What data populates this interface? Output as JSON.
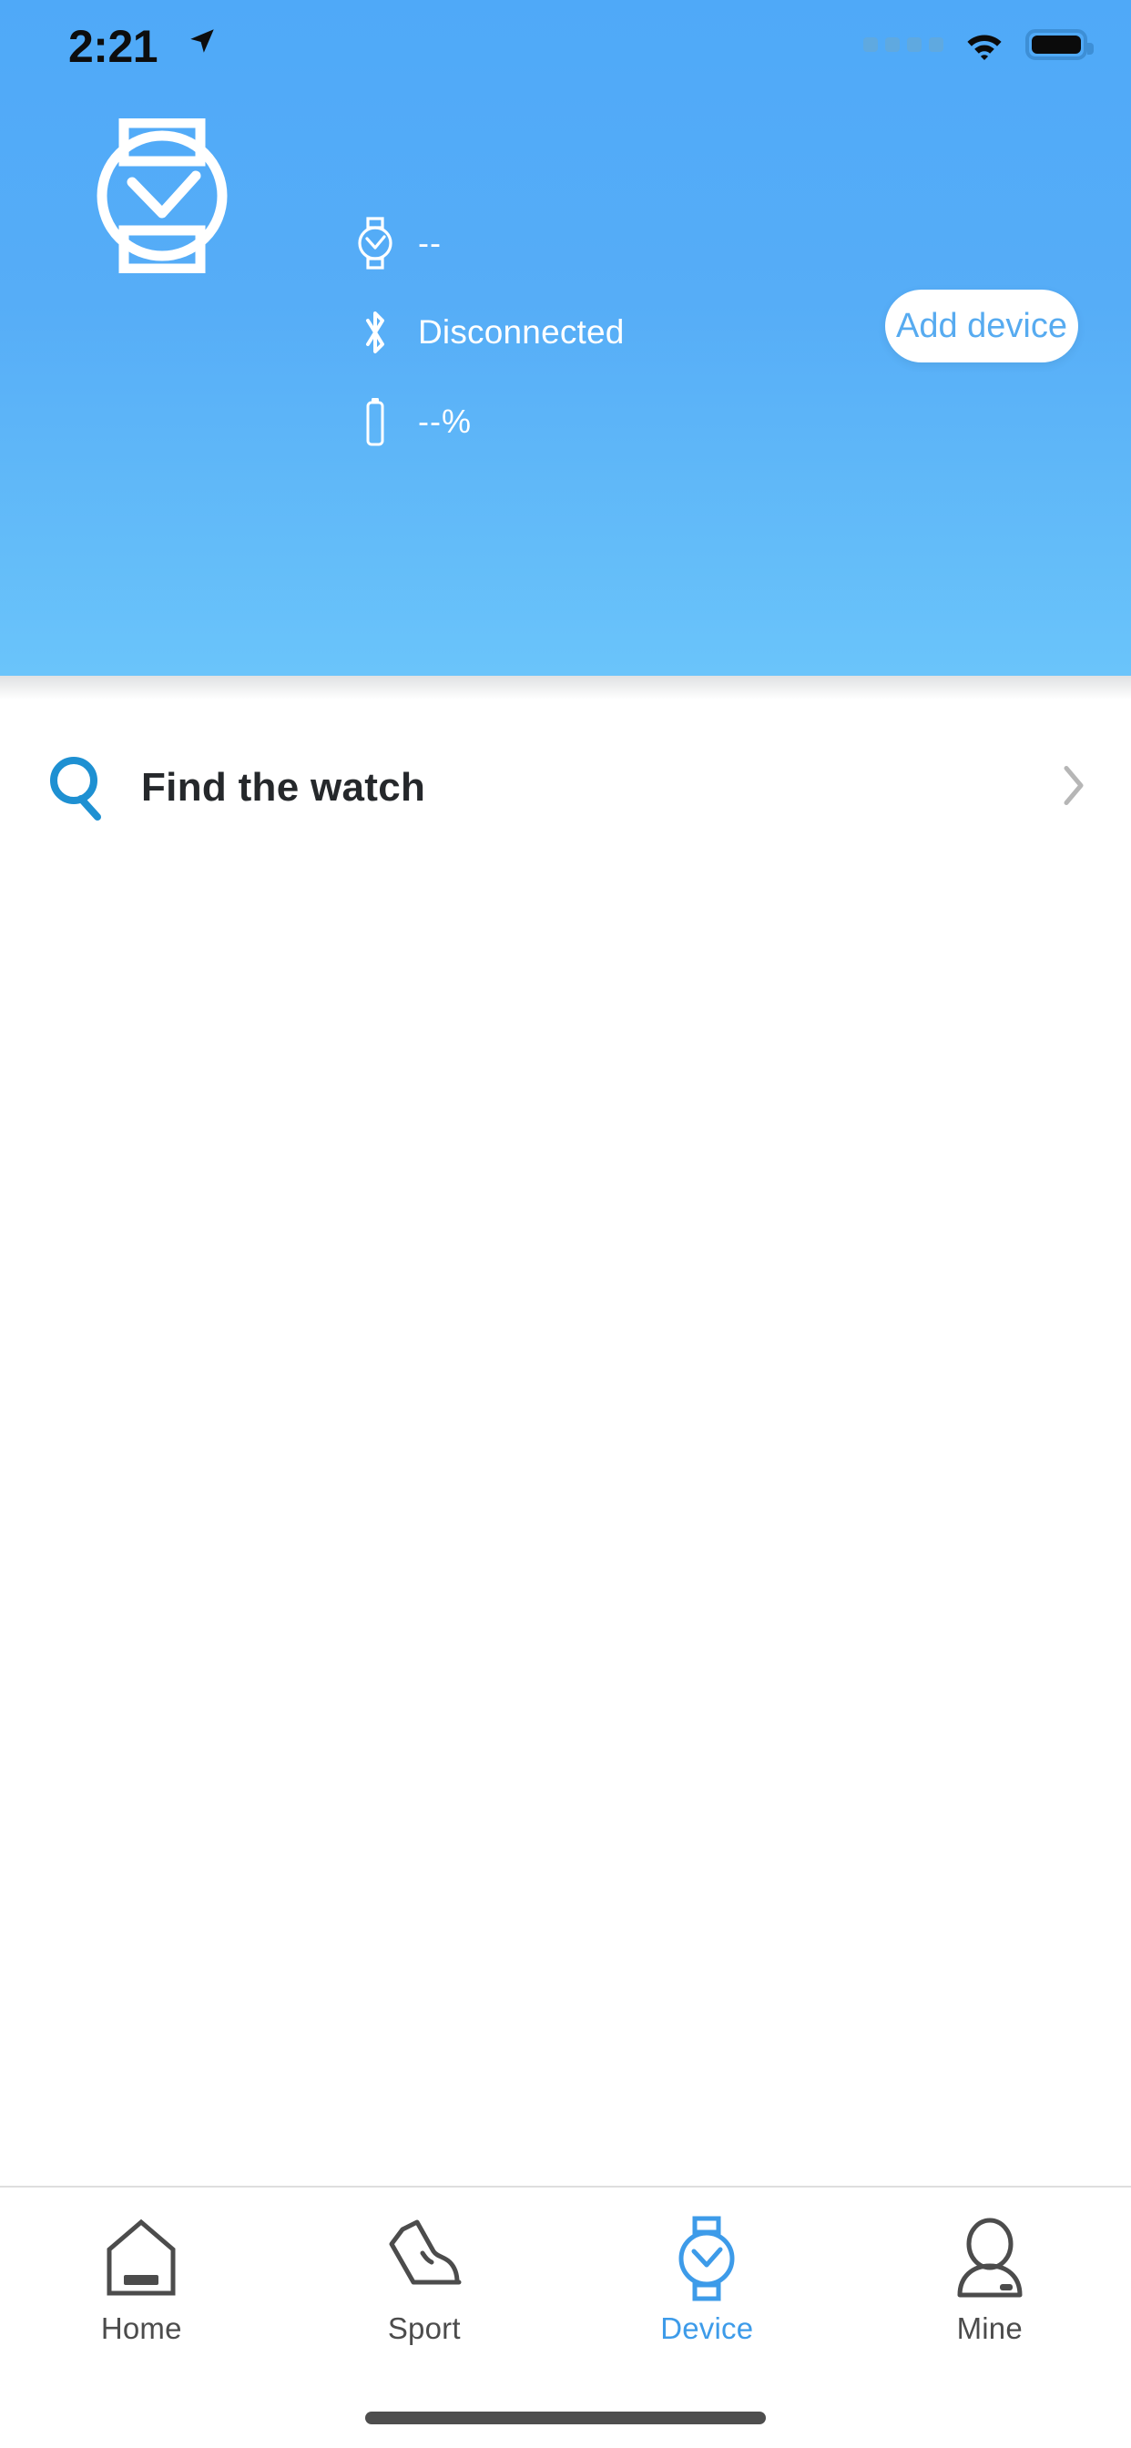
{
  "status_bar": {
    "time": "2:21",
    "location_icon": "location-arrow-icon",
    "signal_icon": "signal-dots-icon",
    "wifi_icon": "wifi-icon",
    "battery_icon": "battery-full-icon"
  },
  "header": {
    "background_color": "#55ADF7",
    "device_illustration": "watch-illustration",
    "info_rows": [
      {
        "icon": "watch-icon",
        "value": "--"
      },
      {
        "icon": "bluetooth-icon",
        "value": "Disconnected"
      },
      {
        "icon": "battery-icon",
        "value": "--%"
      }
    ],
    "add_device_button": {
      "label": "Add device",
      "text_color": "#57ABF0",
      "background_color": "#FFFFFF"
    }
  },
  "list": {
    "rows": [
      {
        "icon": "search-icon",
        "icon_color": "#1E90D2",
        "label": "Find the watch",
        "chevron": "chevron-right-icon"
      }
    ]
  },
  "tab_bar": {
    "active_color": "#3D9BE9",
    "inactive_color": "#4C4C4C",
    "tabs": [
      {
        "id": "home",
        "label": "Home",
        "icon": "home-icon",
        "active": false
      },
      {
        "id": "sport",
        "label": "Sport",
        "icon": "shoe-icon",
        "active": false
      },
      {
        "id": "device",
        "label": "Device",
        "icon": "watch-icon",
        "active": true
      },
      {
        "id": "mine",
        "label": "Mine",
        "icon": "person-icon",
        "active": false
      }
    ]
  },
  "home_indicator": "home-indicator-bar"
}
